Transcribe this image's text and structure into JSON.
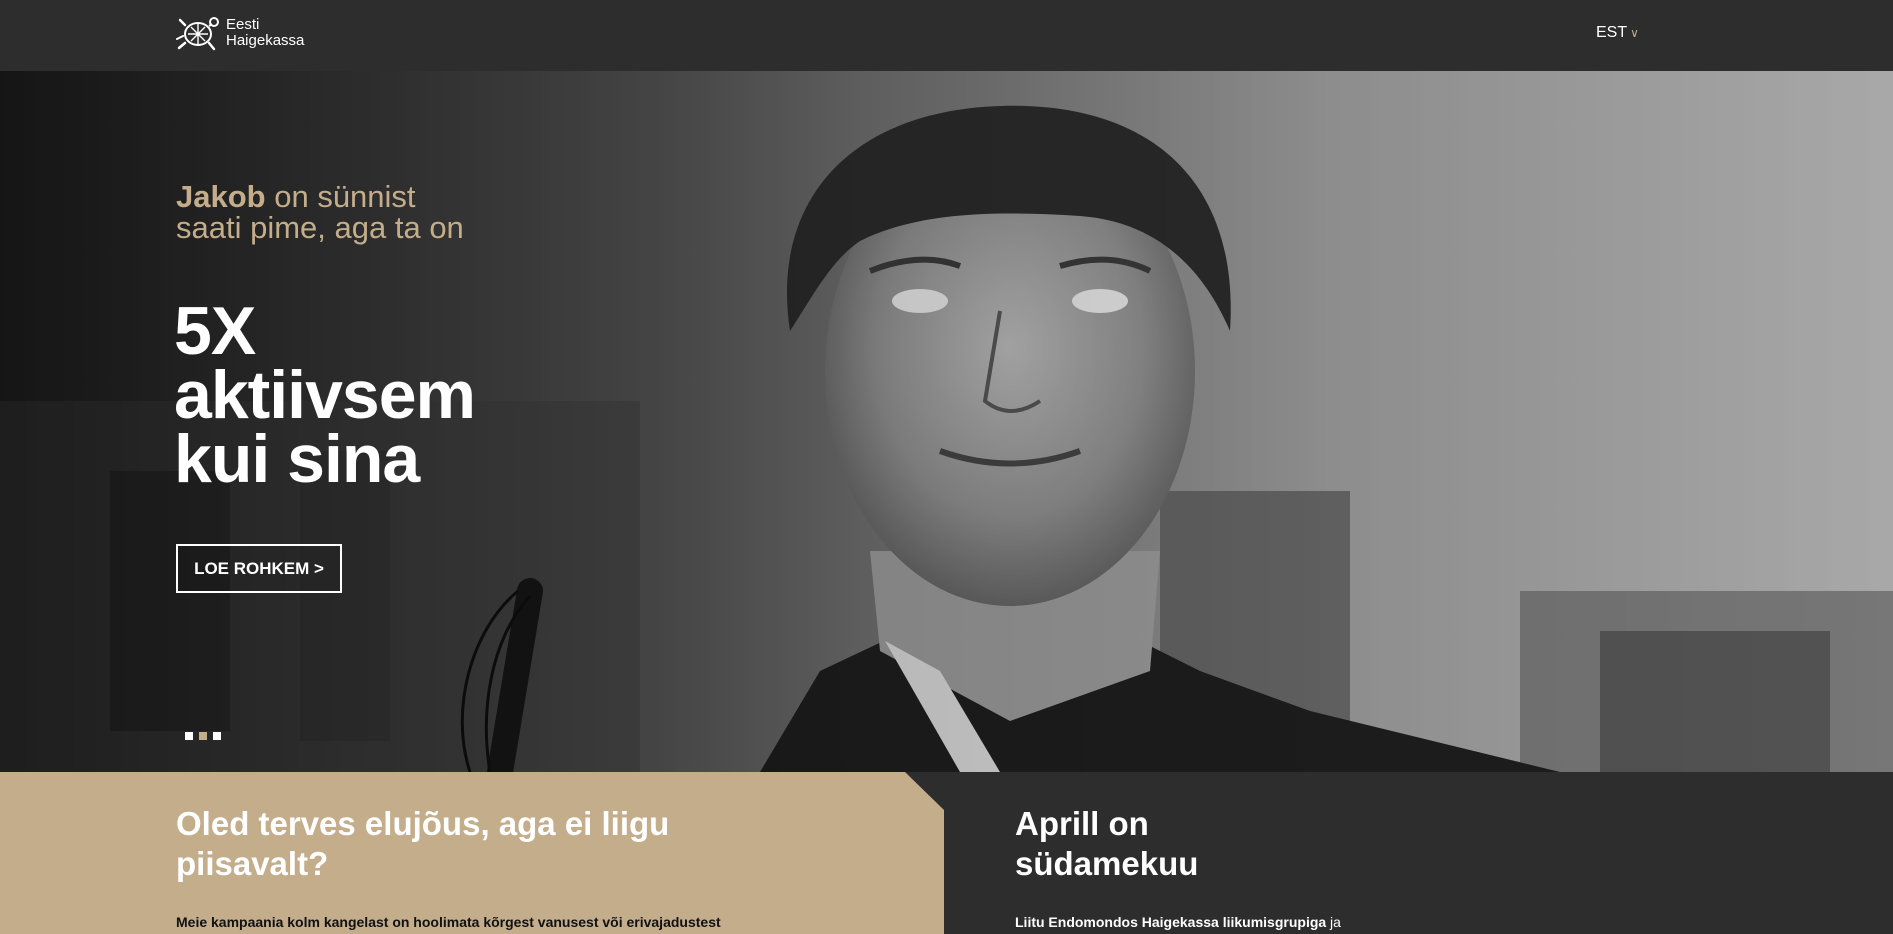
{
  "header": {
    "logo_line1": "Eesti",
    "logo_line2": "Haigekassa",
    "language": "EST"
  },
  "hero": {
    "intro_name": "Jakob",
    "intro_rest_1": " on sünnist",
    "intro_rest_2": "saati pime, aga ta on",
    "headline_1": "5X",
    "headline_2": "aktiivsem",
    "headline_3": "kui sina",
    "cta_label": "LOE ROHKEM >",
    "slide_count": 3,
    "active_slide": 2
  },
  "panels": {
    "left": {
      "title": "Oled terves elujõus, aga ei liigu piisavalt?",
      "text": "Meie kampaania kolm kangelast on hoolimata kõrgest vanusest või erivajadustest"
    },
    "right": {
      "title_1": "Aprill on",
      "title_2": "südamekuu",
      "link_text": "Liitu Endomondos Haigekassa liikumisgrupiga",
      "text_after": " ja"
    }
  },
  "colors": {
    "accent": "#c3ad8b",
    "dark": "#2d2d2d",
    "white": "#ffffff"
  },
  "icons": {
    "logo": "turtle-logo-icon",
    "lang_dropdown": "chevron-down-icon"
  }
}
